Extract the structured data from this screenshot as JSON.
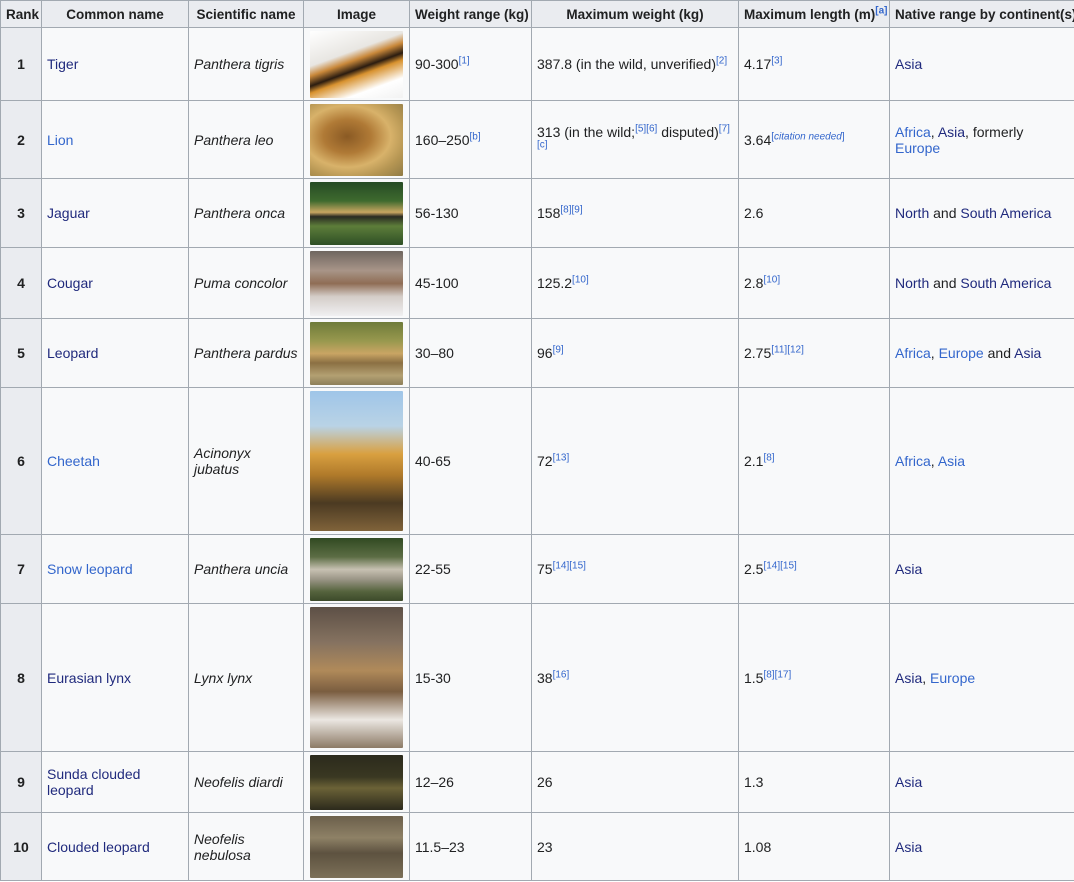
{
  "headers": {
    "rank": "Rank",
    "common": "Common name",
    "scientific": "Scientific name",
    "image": "Image",
    "weight_range": "Weight range (kg)",
    "max_weight": "Maximum weight (kg)",
    "max_length": "Maximum length (m)",
    "max_length_ref": "[a]",
    "native": "Native range by continent(s)"
  },
  "rows": [
    {
      "rank": "1",
      "common": "Tiger",
      "scientific": "Panthera tigris",
      "image_icon": "tiger-photo",
      "wr": "90-300",
      "wr_ref": "[1]",
      "mw": "387.8 (in the wild, unverified)",
      "mw_ref": "[2]",
      "ml": "4.17",
      "ml_ref": "[3]",
      "nr": "Asia"
    },
    {
      "rank": "2",
      "common": "Lion",
      "scientific": "Panthera leo",
      "image_icon": "lion-photo",
      "wr": "160–250",
      "wr_ref": "[b]",
      "mw_a": "313 (in the wild;",
      "mw_ref1": "[5][6]",
      "mw_b": " disputed)",
      "mw_ref2": "[7][c]",
      "ml": "3.64",
      "ml_ref": "citation needed",
      "nr_1": "Africa",
      "nr_sep1": ", ",
      "nr_2": "Asia",
      "nr_sep2": ", formerly ",
      "nr_3": "Europe"
    },
    {
      "rank": "3",
      "common": "Jaguar",
      "scientific": "Panthera onca",
      "image_icon": "jaguar-photo",
      "wr": "56-130",
      "mw": "158",
      "mw_ref": "[8][9]",
      "ml": "2.6",
      "nr_1": "North",
      "nr_sep1": " and ",
      "nr_2": "South America"
    },
    {
      "rank": "4",
      "common": "Cougar",
      "scientific": "Puma concolor",
      "image_icon": "cougar-photo",
      "wr": "45-100",
      "mw": "125.2",
      "mw_ref": "[10]",
      "ml": "2.8",
      "ml_ref": "[10]",
      "nr_1": "North",
      "nr_sep1": " and ",
      "nr_2": "South America"
    },
    {
      "rank": "5",
      "common": "Leopard",
      "scientific": "Panthera pardus",
      "image_icon": "leopard-photo",
      "wr": "30–80",
      "mw": "96",
      "mw_ref": "[9]",
      "ml": "2.75",
      "ml_ref": "[11][12]",
      "nr_1": "Africa",
      "nr_sep1": ", ",
      "nr_2": "Europe",
      "nr_sep2": " and ",
      "nr_3": "Asia"
    },
    {
      "rank": "6",
      "common": "Cheetah",
      "scientific": "Acinonyx jubatus",
      "image_icon": "cheetah-photo",
      "wr": "40-65",
      "mw": "72",
      "mw_ref": "[13]",
      "ml": "2.1",
      "ml_ref": "[8]",
      "nr_1": "Africa",
      "nr_sep1": ", ",
      "nr_2": "Asia"
    },
    {
      "rank": "7",
      "common": "Snow leopard",
      "scientific": "Panthera uncia",
      "image_icon": "snow-leopard-photo",
      "wr": "22-55",
      "mw": "75",
      "mw_ref": "[14][15]",
      "ml": "2.5",
      "ml_ref": "[14][15]",
      "nr": "Asia"
    },
    {
      "rank": "8",
      "common": "Eurasian lynx",
      "scientific": "Lynx lynx",
      "image_icon": "eurasian-lynx-photo",
      "wr": "15-30",
      "mw": "38",
      "mw_ref": "[16]",
      "ml": "1.5",
      "ml_ref": "[8][17]",
      "nr_1": "Asia",
      "nr_sep1": ", ",
      "nr_2": "Europe"
    },
    {
      "rank": "9",
      "common": "Sunda clouded leopard",
      "scientific": "Neofelis diardi",
      "image_icon": "sunda-clouded-leopard-photo",
      "wr": "12–26",
      "mw": "26",
      "ml": "1.3",
      "nr": "Asia"
    },
    {
      "rank": "10",
      "common": "Clouded leopard",
      "scientific": "Neofelis nebulosa",
      "image_icon": "clouded-leopard-photo",
      "wr": "11.5–23",
      "mw": "23",
      "ml": "1.08",
      "nr": "Asia"
    }
  ],
  "colors": {
    "link": "#202a7d",
    "link_visited": "#3366cc",
    "header_bg": "#eaecf0",
    "cell_bg": "#f8f9fa",
    "border": "#a2a9b1"
  }
}
